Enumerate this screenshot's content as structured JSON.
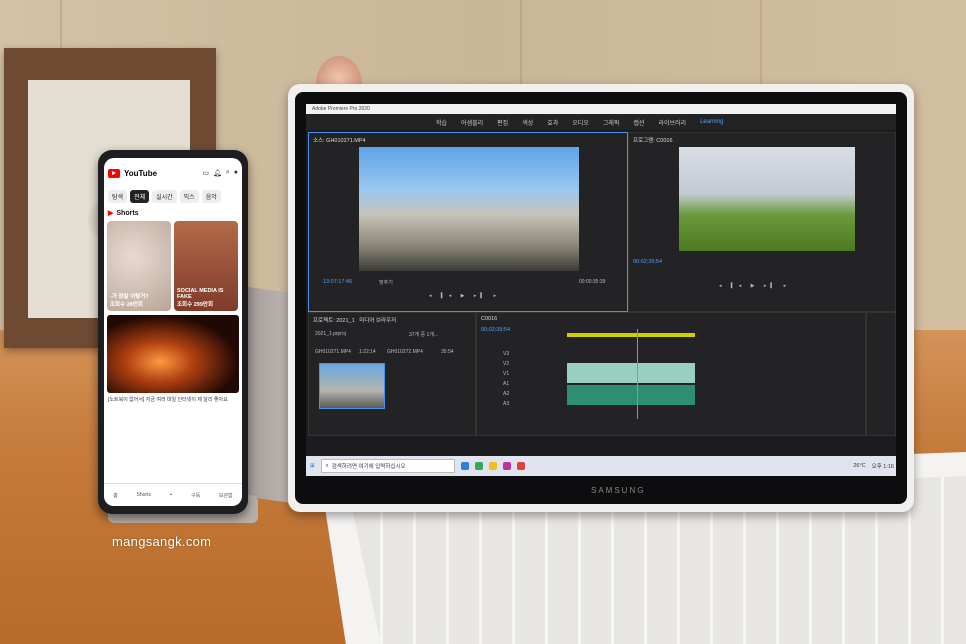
{
  "phone": {
    "app_name": "YouTube",
    "chips": [
      "탐색",
      "전체",
      "실시간",
      "믹스",
      "음악"
    ],
    "shorts_label": "Shorts",
    "shorts": [
      {
        "caption": "-가 정말 이렇거?",
        "views": "조회수 28만회"
      },
      {
        "caption": "SOCIAL MEDIA IS FAKE",
        "views": "조회수 299만회"
      }
    ],
    "video_text": "[노트북이 없어서] 지금 여러 대일 인터넷이 제 달리 좋아요",
    "nav": [
      "홈",
      "Shorts",
      "+",
      "구독",
      "보관함"
    ]
  },
  "premiere": {
    "title_bar": "Adobe Premiere Pro 2020",
    "menu": [
      "학습",
      "어셈블리",
      "편집",
      "색상",
      "효과",
      "오디오",
      "그래픽",
      "캡션",
      "라이브러리",
      "Learning"
    ],
    "active_menu": "Learning",
    "source_title": "소스: GH010271.MP4",
    "source_timecode": "13:07:17:46",
    "source_fit": "맞추기",
    "source_duration": "00:00:35:39",
    "program_title": "프로그램: C0016",
    "program_timecode": "00:02;39;54",
    "project_title": "프로젝트: 2021_1",
    "project_file": "2021_1.prproj",
    "media_browser": "미디어 브라우저",
    "items_count": "37개 중 1개...",
    "clips": [
      {
        "name": "GH010271.MP4",
        "duration": "1:22:14"
      },
      {
        "name": "GH010272.MP4",
        "duration": "35:54"
      }
    ],
    "sequence_name": "C0016",
    "timeline_timecode": "00;02;39;54",
    "tracks": [
      "V3",
      "V2",
      "V1",
      "A1",
      "A2",
      "A3"
    ],
    "taskbar_search": "검색하려면 여기에 입력하십시오",
    "weather": "26°C",
    "clock": "오후 1:16"
  },
  "laptop_brand": "SAMSUNG",
  "watermark": "mangsangk.com"
}
